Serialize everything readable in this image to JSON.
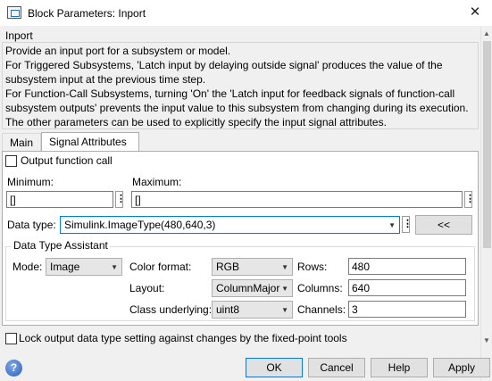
{
  "window": {
    "title": "Block Parameters: Inport",
    "close_glyph": "✕"
  },
  "header": {
    "section": "Inport",
    "description": "Provide an input port for a subsystem or model.\nFor Triggered Subsystems, 'Latch input by delaying outside signal' produces the value of the\nsubsystem input at the previous time step.\nFor Function-Call Subsystems, turning 'On' the 'Latch input for feedback signals of function-call\nsubsystem outputs' prevents the input value to this subsystem from changing during its execution.\nThe other parameters can be used to explicitly specify the input signal attributes."
  },
  "tabs": [
    {
      "label": "Main",
      "selected": false
    },
    {
      "label": "Signal Attributes",
      "selected": true
    }
  ],
  "signal_attributes": {
    "output_function_call": {
      "label": "Output function call",
      "checked": false
    },
    "minimum": {
      "label": "Minimum:",
      "value": "[]"
    },
    "maximum": {
      "label": "Maximum:",
      "value": "[]"
    },
    "data_type": {
      "label": "Data type:",
      "value": "Simulink.ImageType(480,640,3)",
      "assistant_button": "<<"
    },
    "assistant": {
      "title": "Data Type Assistant",
      "mode": {
        "label": "Mode:",
        "value": "Image"
      },
      "color_format": {
        "label": "Color format:",
        "value": "RGB"
      },
      "layout": {
        "label": "Layout:",
        "value": "ColumnMajor"
      },
      "class_underlying": {
        "label": "Class underlying:",
        "value": "uint8"
      },
      "rows": {
        "label": "Rows:",
        "value": "480"
      },
      "columns": {
        "label": "Columns:",
        "value": "640"
      },
      "channels": {
        "label": "Channels:",
        "value": "3"
      }
    },
    "lock_output": {
      "label": "Lock output data type setting against changes by the fixed-point tools",
      "checked": false
    }
  },
  "footer": {
    "help_icon_glyph": "?",
    "ok": "OK",
    "cancel": "Cancel",
    "help": "Help",
    "apply": "Apply"
  },
  "icons": {
    "app": "block-parameters-icon",
    "close": "close-icon",
    "help": "help-icon",
    "dropdown": "chevron-down-icon",
    "more": "vertical-dots-icon"
  },
  "colors": {
    "accent": "#0078d7",
    "dialog_bg": "#f0f0f0",
    "panel_bg": "#ffffff"
  }
}
